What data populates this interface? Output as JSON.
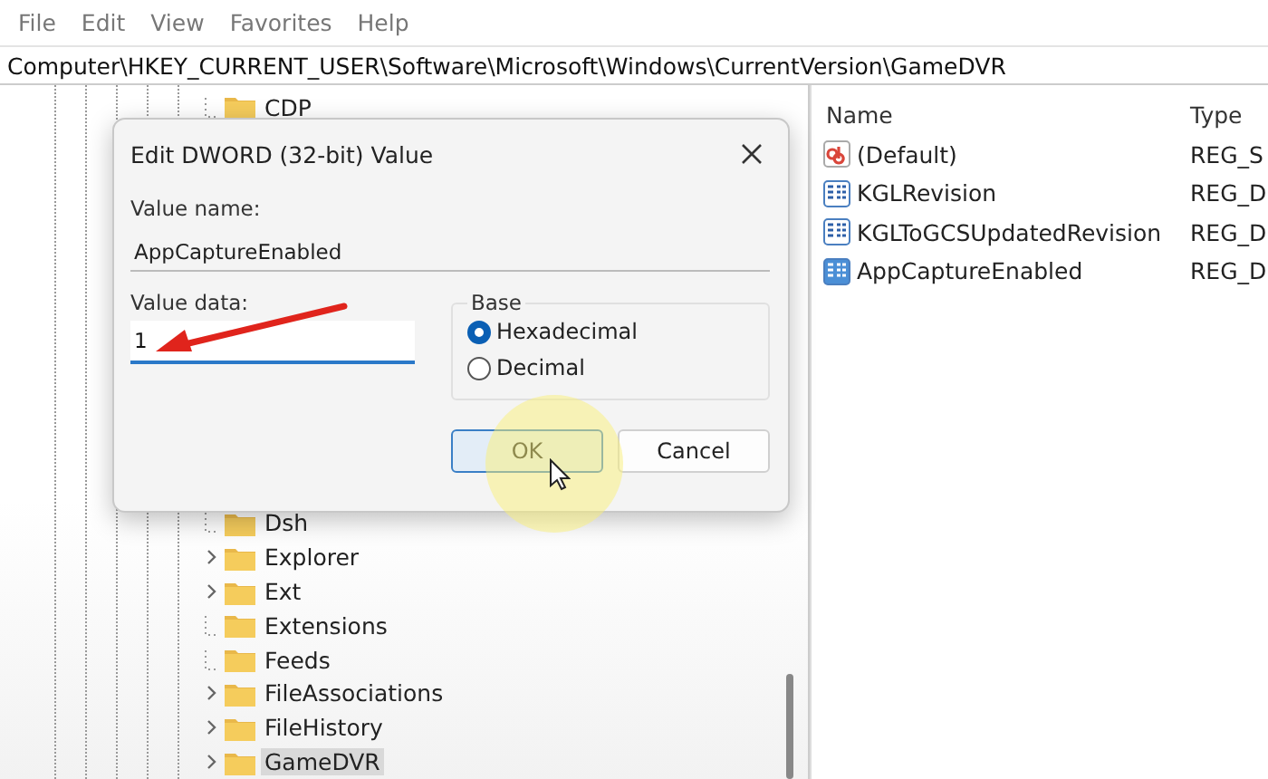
{
  "menu": [
    "File",
    "Edit",
    "View",
    "Favorites",
    "Help"
  ],
  "address": "Computer\\HKEY_CURRENT_USER\\Software\\Microsoft\\Windows\\CurrentVersion\\GameDVR",
  "tree_top": [
    {
      "label": "CDP",
      "expandable": false,
      "selected": false
    }
  ],
  "tree_bottom": [
    {
      "label": "Dsh",
      "expandable": false,
      "selected": false
    },
    {
      "label": "Explorer",
      "expandable": true,
      "selected": false
    },
    {
      "label": "Ext",
      "expandable": true,
      "selected": false
    },
    {
      "label": "Extensions",
      "expandable": false,
      "selected": false
    },
    {
      "label": "Feeds",
      "expandable": false,
      "selected": false
    },
    {
      "label": "FileAssociations",
      "expandable": true,
      "selected": false
    },
    {
      "label": "FileHistory",
      "expandable": true,
      "selected": false
    },
    {
      "label": "GameDVR",
      "expandable": true,
      "selected": true
    }
  ],
  "values": {
    "columns": [
      "Name",
      "Type"
    ],
    "rows": [
      {
        "kind": "string",
        "name": "(Default)",
        "type": "REG_S",
        "selected": false
      },
      {
        "kind": "dword",
        "name": "KGLRevision",
        "type": "REG_D",
        "selected": false
      },
      {
        "kind": "dword",
        "name": "KGLToGCSUpdatedRevision",
        "type": "REG_D",
        "selected": false
      },
      {
        "kind": "dword",
        "name": "AppCaptureEnabled",
        "type": "REG_D",
        "selected": true
      }
    ]
  },
  "dialog": {
    "title": "Edit DWORD (32-bit) Value",
    "value_name_label": "Value name:",
    "value_name": "AppCaptureEnabled",
    "value_data_label": "Value data:",
    "value_data": "1",
    "base_label": "Base",
    "bases": [
      {
        "label": "Hexadecimal",
        "selected": true
      },
      {
        "label": "Decimal",
        "selected": false
      }
    ],
    "buttons": [
      {
        "label": "OK",
        "default": true
      },
      {
        "label": "Cancel",
        "default": false
      }
    ]
  }
}
